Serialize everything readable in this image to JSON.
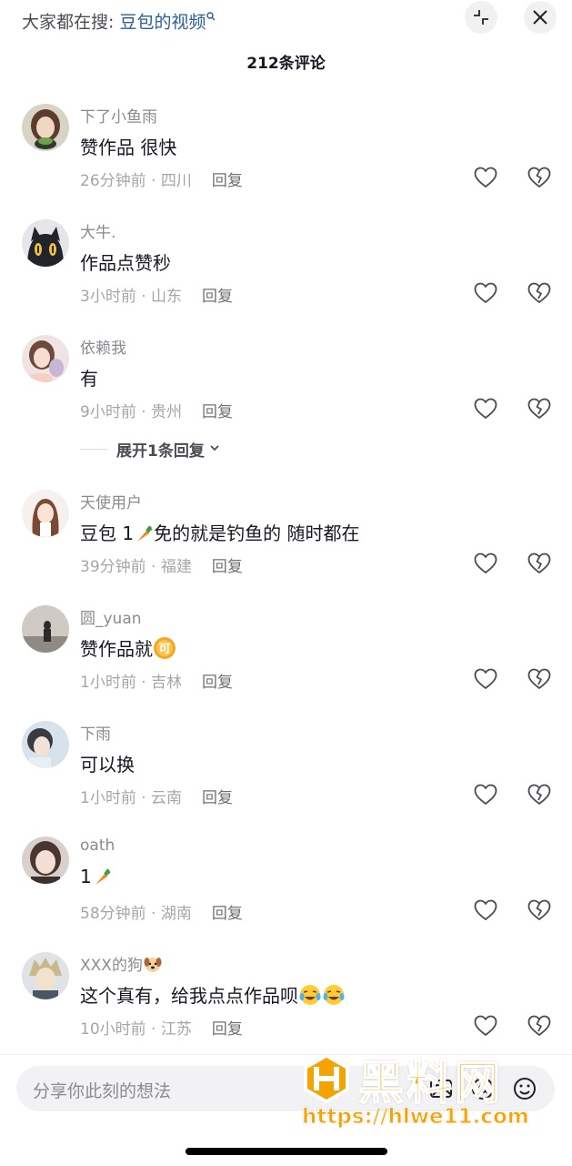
{
  "header": {
    "search_prefix": "大家都在搜:",
    "search_term": "豆包的视频",
    "comment_count": "212条评论"
  },
  "comments": [
    {
      "user": "下了小鱼雨",
      "text": "赞作品 很快",
      "time": "26分钟前 · 四川",
      "reply": "回复"
    },
    {
      "user": "大牛.",
      "text": "作品点赞秒",
      "time": "3小时前 · 山东",
      "reply": "回复"
    },
    {
      "user": "依赖我",
      "text": "有",
      "time": "9小时前 · 贵州",
      "reply": "回复",
      "expand": "展开1条回复"
    },
    {
      "user": "天使用户",
      "text_a": "豆包 1",
      "text_b": "免的就是钓鱼的 随时都在",
      "time": "39分钟前 · 福建",
      "reply": "回复"
    },
    {
      "user": "圆_yuan",
      "text": "赞作品就",
      "time": "1小时前 · 吉林",
      "reply": "回复"
    },
    {
      "user": "下雨",
      "text": "可以换",
      "time": "1小时前 · 云南",
      "reply": "回复"
    },
    {
      "user": "oath",
      "text": "1",
      "time": "58分钟前 · 湖南",
      "reply": "回复"
    },
    {
      "user": "XXX的狗",
      "text": "这个真有，给我点点作品呗",
      "time": "10小时前 · 江苏",
      "reply": "回复"
    }
  ],
  "input": {
    "placeholder": "分享你此刻的想法"
  },
  "watermark": {
    "title": "黑料网",
    "url": "https://hlwe11.com"
  },
  "icons": {
    "collapse": "collapse-arrows-icon",
    "close": "close-icon",
    "like": "heart-outline-icon",
    "dislike": "broken-heart-icon",
    "chevron": "chevron-down-icon",
    "carrot": "carrot-emoji",
    "coin": "coin-ke-emoji",
    "dog": "dog-emoji",
    "crying": "crying-laughing-emoji"
  },
  "colors": {
    "search_term": "#2a5d9c",
    "watermark": "#f5a300",
    "text_primary": "#161823",
    "text_secondary": "#8a8b91"
  }
}
